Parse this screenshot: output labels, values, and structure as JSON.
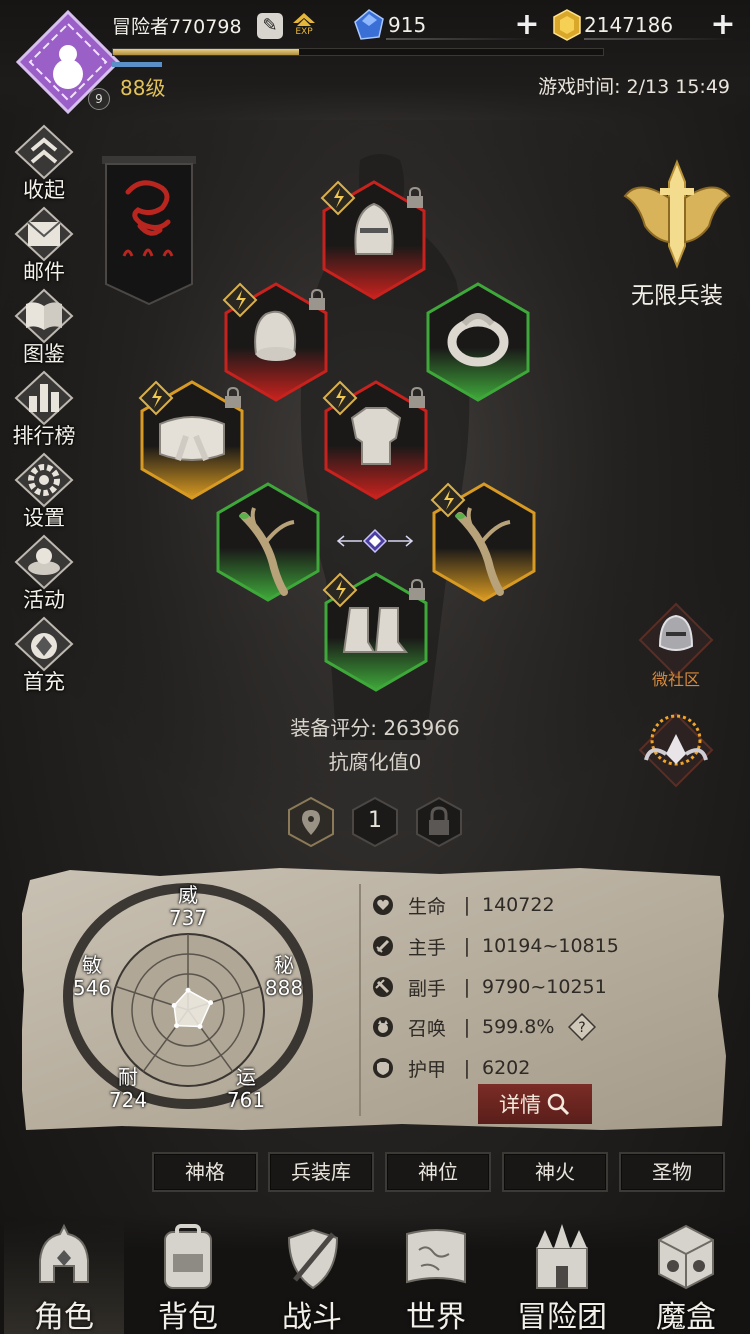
{
  "player": {
    "name": "冒险者770798",
    "level_label": "88级",
    "avatar_level": "9",
    "exp_fraction": 0.38,
    "exp_icon_text": "EXP"
  },
  "currency": {
    "gem_value": "915",
    "gold_value": "2147186"
  },
  "game_time": "游戏时间: 2/13 15:49",
  "side_menu": [
    {
      "label": "收起",
      "icon": "collapse-icon"
    },
    {
      "label": "邮件",
      "icon": "mail-icon"
    },
    {
      "label": "图鉴",
      "icon": "book-icon"
    },
    {
      "label": "排行榜",
      "icon": "leaderboard-icon"
    },
    {
      "label": "设置",
      "icon": "gear-icon"
    },
    {
      "label": "活动",
      "icon": "event-icon"
    },
    {
      "label": "首充",
      "icon": "first-recharge-icon"
    }
  ],
  "right_side": {
    "infinite_arms_label": "无限兵装",
    "community_label": "微社区"
  },
  "equipment": {
    "slots": [
      {
        "name": "helmet",
        "icon": "helmet-icon",
        "quality": "red",
        "locked": true
      },
      {
        "name": "gloves",
        "icon": "gauntlet-icon",
        "quality": "red",
        "locked": true
      },
      {
        "name": "ring",
        "icon": "ring-icon",
        "quality": "green",
        "locked": false
      },
      {
        "name": "belt",
        "icon": "belt-icon",
        "quality": "gold",
        "locked": true
      },
      {
        "name": "armor",
        "icon": "armor-icon",
        "quality": "red",
        "locked": true
      },
      {
        "name": "weapon-left",
        "icon": "branch-icon",
        "quality": "green",
        "locked": false
      },
      {
        "name": "weapon-right",
        "icon": "branch-icon",
        "quality": "gold",
        "locked": false
      },
      {
        "name": "boots",
        "icon": "boots-icon",
        "quality": "green",
        "locked": true
      }
    ],
    "score_label": "装备评分: 263966",
    "corrosion_label": "抗腐化值0"
  },
  "pages": {
    "current": "1"
  },
  "attributes": [
    {
      "name": "威",
      "value": "737"
    },
    {
      "name": "秘",
      "value": "888"
    },
    {
      "name": "运",
      "value": "761"
    },
    {
      "name": "耐",
      "value": "724"
    },
    {
      "name": "敏",
      "value": "546"
    }
  ],
  "stats": [
    {
      "name": "生命",
      "sep": "|",
      "value": "140722",
      "icon": "heart-icon"
    },
    {
      "name": "主手",
      "sep": "|",
      "value": "10194~10815",
      "icon": "sword-icon"
    },
    {
      "name": "副手",
      "sep": "|",
      "value": "9790~10251",
      "icon": "dagger-icon"
    },
    {
      "name": "召唤",
      "sep": "|",
      "value": "599.8%",
      "icon": "summon-icon"
    },
    {
      "name": "护甲",
      "sep": "|",
      "value": "6202",
      "icon": "armor-stat-icon"
    }
  ],
  "detail_button_label": "详情",
  "tabs": [
    "神格",
    "兵装库",
    "神位",
    "神火",
    "圣物"
  ],
  "bottom_nav": [
    {
      "label": "角色",
      "icon": "character-icon",
      "active": true
    },
    {
      "label": "背包",
      "icon": "backpack-icon",
      "active": false
    },
    {
      "label": "战斗",
      "icon": "battle-icon",
      "active": false
    },
    {
      "label": "世界",
      "icon": "world-map-icon",
      "active": false
    },
    {
      "label": "冒险团",
      "icon": "guild-icon",
      "active": false
    },
    {
      "label": "魔盒",
      "icon": "magic-box-icon",
      "active": false
    }
  ],
  "colors": {
    "gold_accent": "#e2c35a",
    "red_quality": "#c8221e",
    "green_quality": "#3fa83a",
    "gold_quality": "#d89a22",
    "avatar_purple": "#9b5fc8"
  }
}
